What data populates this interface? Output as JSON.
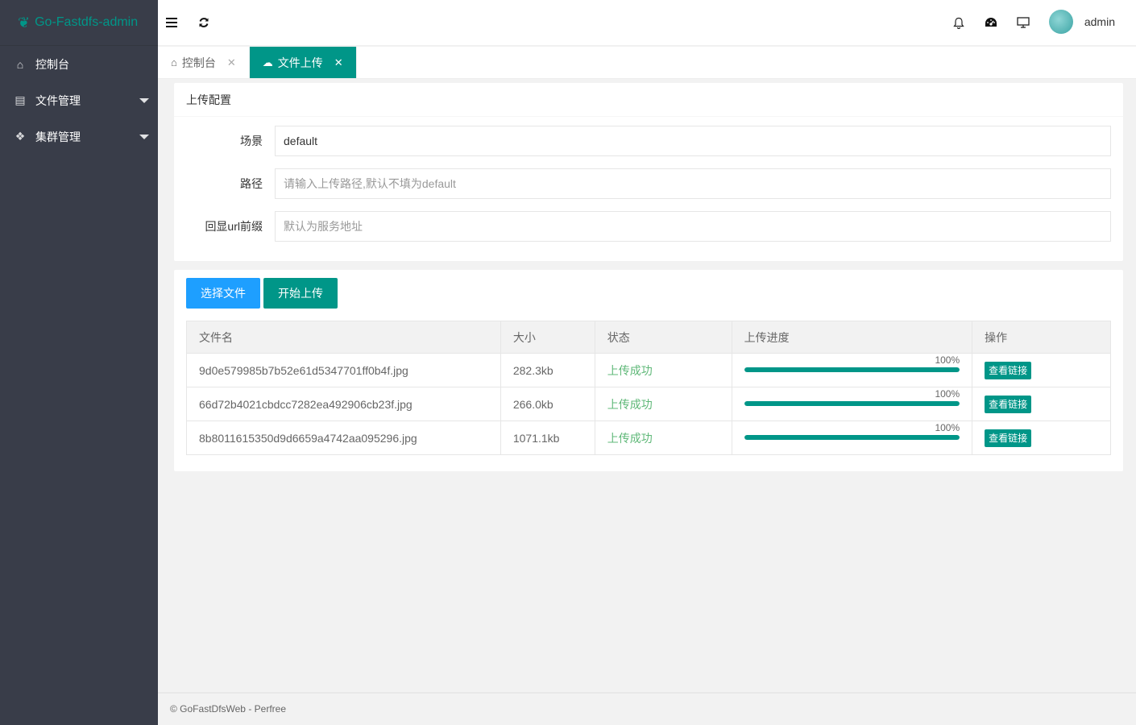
{
  "app": {
    "title": "Go-Fastdfs-admin"
  },
  "sidebar": {
    "items": [
      {
        "label": "控制台",
        "icon": "home-icon"
      },
      {
        "label": "文件管理",
        "icon": "file-icon"
      },
      {
        "label": "集群管理",
        "icon": "cubes-icon"
      }
    ]
  },
  "header": {
    "username": "admin"
  },
  "tabs": [
    {
      "label": "控制台",
      "icon": "home-icon"
    },
    {
      "label": "文件上传",
      "icon": "cloud-upload-icon",
      "active": true
    }
  ],
  "upload_config": {
    "title": "上传配置",
    "scene_label": "场景",
    "scene_value": "default",
    "path_label": "路径",
    "path_placeholder": "请输入上传路径,默认不填为default",
    "prefix_label": "回显url前缀",
    "prefix_placeholder": "默认为服务地址"
  },
  "upload": {
    "choose_label": "选择文件",
    "start_label": "开始上传",
    "columns": [
      "文件名",
      "大小",
      "状态",
      "上传进度",
      "操作"
    ],
    "rows": [
      {
        "name": "9d0e579985b7b52e61d5347701ff0b4f.jpg",
        "size": "282.3kb",
        "status": "上传成功",
        "progress": 100,
        "progress_text": "100%",
        "action": "查看链接"
      },
      {
        "name": "66d72b4021cbdcc7282ea492906cb23f.jpg",
        "size": "266.0kb",
        "status": "上传成功",
        "progress": 100,
        "progress_text": "100%",
        "action": "查看链接"
      },
      {
        "name": "8b8011615350d9d6659a4742aa095296.jpg",
        "size": "1071.1kb",
        "status": "上传成功",
        "progress": 100,
        "progress_text": "100%",
        "action": "查看链接"
      }
    ]
  },
  "footer": {
    "text": "© GoFastDfsWeb - Perfree"
  },
  "colors": {
    "accent": "#009688",
    "blue": "#1e9fff",
    "success": "#5fb878",
    "sidebar": "#393d49"
  }
}
